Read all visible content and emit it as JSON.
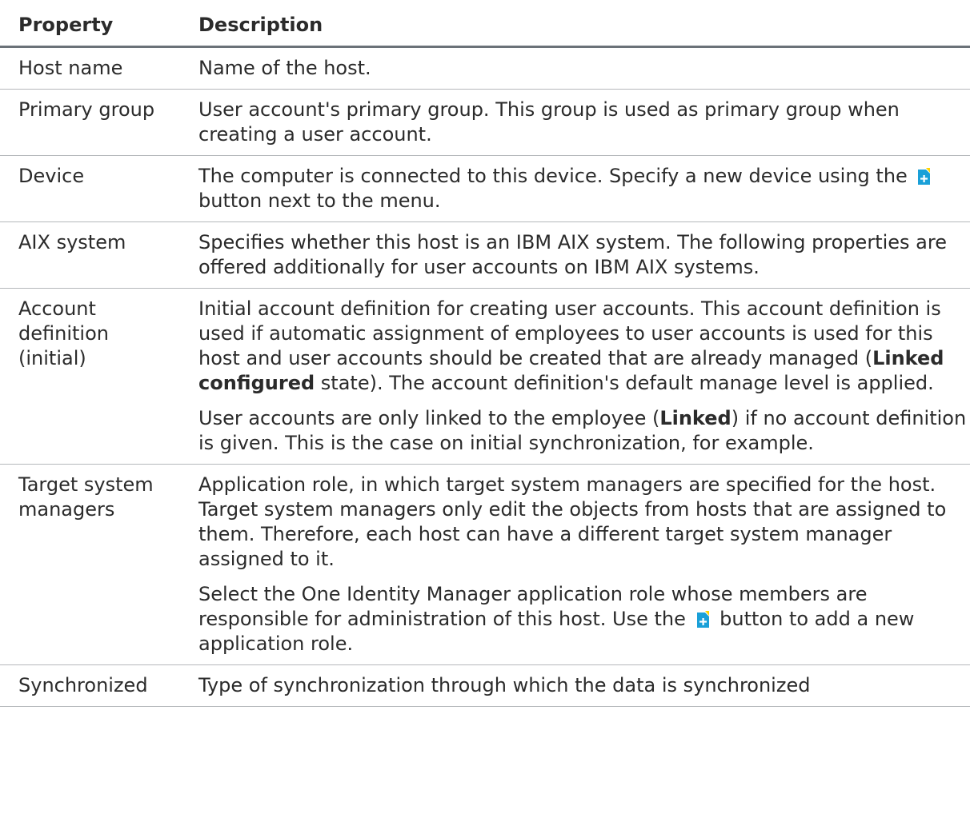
{
  "table": {
    "headers": {
      "property": "Property",
      "description": "Description"
    },
    "rows": {
      "host_name": {
        "property": "Host name",
        "description": "Name of the host."
      },
      "primary_group": {
        "property": "Primary group",
        "description": "User account's primary group. This group is used as primary group when creating a user account."
      },
      "device": {
        "property": "Device",
        "desc_before_icon": "The computer is connected to this device. Specify a new device using the",
        "desc_after_icon": "button next to the menu."
      },
      "aix_system": {
        "property": "AIX system",
        "description": "Specifies whether this host is an IBM AIX system. The following properties are offered additionally for user accounts on IBM AIX systems."
      },
      "account_definition": {
        "property": "Account definition (initial)",
        "p1_part1": "Initial account definition for creating user accounts. This account definition is used if automatic assignment of employees to user accounts is used for this host and user accounts should be created that are already managed (",
        "p1_bold": "Linked configured",
        "p1_part2": " state). The account definition's default manage level is applied.",
        "p2_part1": "User accounts are only linked to the employee (",
        "p2_bold": "Linked",
        "p2_part2": ") if no account definition is given. This is the case on initial synchronization, for example."
      },
      "target_system_managers": {
        "property": "Target system managers",
        "p1": "Application role, in which target system managers are specified for the host. Target system managers only edit the objects from hosts that are assigned to them. Therefore, each host can have a different target system manager assigned to it.",
        "p2_before_icon": "Select the One Identity Manager application role whose members are responsible for administration of this host. Use the",
        "p2_after_icon": "button to add a new application role."
      },
      "synchronized_by": {
        "property": "Synchronized",
        "description": "Type of synchronization through which the data is synchronized"
      }
    }
  },
  "icons": {
    "add": {
      "name": "add-icon",
      "color": "#1aa0d8",
      "accent": "#ffd400"
    }
  }
}
